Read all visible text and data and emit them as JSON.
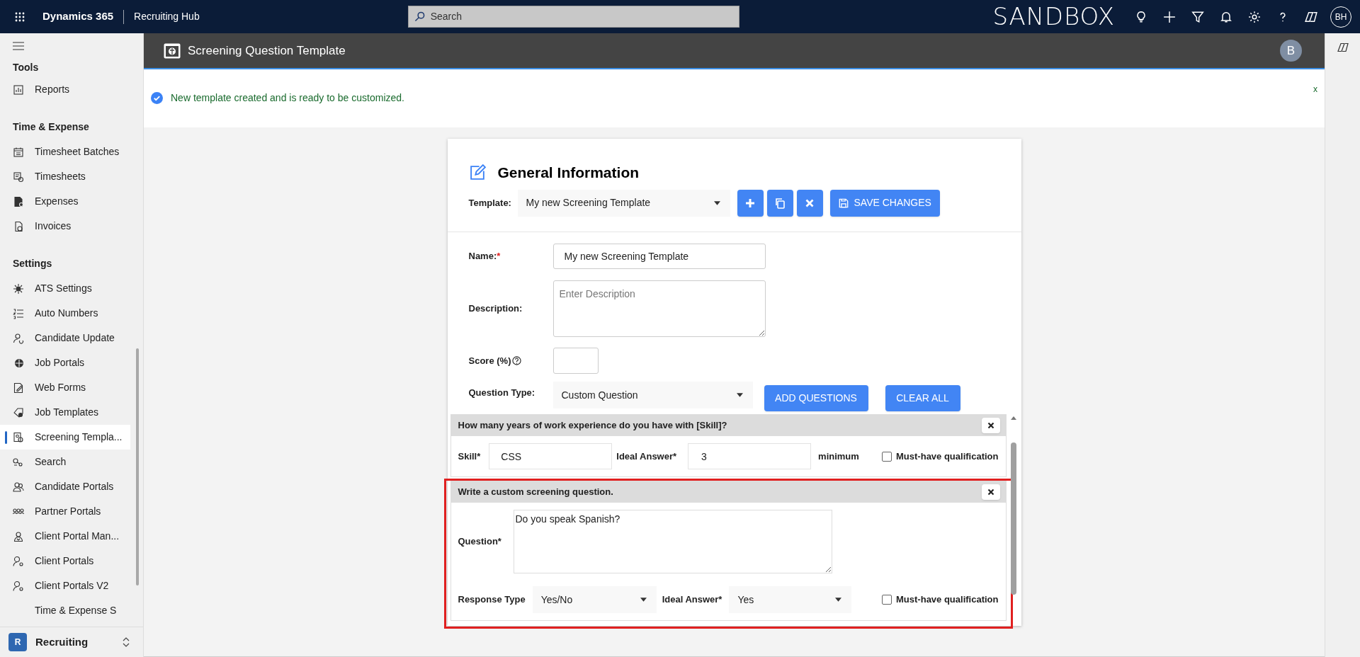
{
  "app_bar": {
    "app_name": "Dynamics 365",
    "area": "Recruiting Hub",
    "search_placeholder": "Search",
    "environment": "SANDBOX",
    "user_initials": "BH"
  },
  "sidebar": {
    "sections": [
      {
        "title": "Tools",
        "items": [
          {
            "label": "Reports",
            "selected": false
          }
        ]
      },
      {
        "title": "Time & Expense",
        "items": [
          {
            "label": "Timesheet Batches",
            "selected": false
          },
          {
            "label": "Timesheets",
            "selected": false
          },
          {
            "label": "Expenses",
            "selected": false
          },
          {
            "label": "Invoices",
            "selected": false
          }
        ]
      },
      {
        "title": "Settings",
        "items": [
          {
            "label": "ATS Settings",
            "selected": false
          },
          {
            "label": "Auto Numbers",
            "selected": false
          },
          {
            "label": "Candidate Update",
            "selected": false
          },
          {
            "label": "Job Portals",
            "selected": false
          },
          {
            "label": "Web Forms",
            "selected": false
          },
          {
            "label": "Job Templates",
            "selected": false
          },
          {
            "label": "Screening Templa...",
            "selected": true
          },
          {
            "label": "Search",
            "selected": false
          },
          {
            "label": "Candidate Portals",
            "selected": false
          },
          {
            "label": "Partner Portals",
            "selected": false
          },
          {
            "label": "Client Portal Man...",
            "selected": false
          },
          {
            "label": "Client Portals",
            "selected": false
          },
          {
            "label": "Client Portals V2",
            "selected": false
          },
          {
            "label": "Time & Expense S",
            "selected": false
          }
        ]
      }
    ],
    "footer": {
      "badge": "R",
      "label": "Recruiting"
    }
  },
  "page_header": {
    "title": "Screening Question Template",
    "avatar": "B"
  },
  "notification": {
    "message": "New template created and is ready to be customized.",
    "close": "x"
  },
  "form": {
    "title": "General Information",
    "template_label": "Template:",
    "template_value": "My new Screening Template",
    "save_button": "SAVE CHANGES",
    "name_label": "Name:",
    "name_required": "*",
    "name_value": "My new Screening Template",
    "description_label": "Description:",
    "description_placeholder": "Enter Description",
    "score_label": "Score (%)",
    "question_type_label": "Question Type:",
    "question_type_value": "Custom Question",
    "add_button": "ADD QUESTIONS",
    "clear_button": "CLEAR ALL"
  },
  "questions": [
    {
      "kind": "skill",
      "title": "How many years of work experience do you have with [Skill]?",
      "highlighted": false,
      "skill_label": "Skill*",
      "skill_value": "CSS",
      "answer_label": "Ideal Answer*",
      "answer_value": "3",
      "suffix": "minimum",
      "must_have": {
        "label": "Must-have qualification",
        "checked": false
      }
    },
    {
      "kind": "custom",
      "title": "Write a custom screening question.",
      "highlighted": true,
      "question_label": "Question*",
      "question_value": "Do you speak Spanish?",
      "response_label": "Response Type",
      "response_value": "Yes/No",
      "answer_label": "Ideal Answer*",
      "answer_value": "Yes",
      "must_have": {
        "label": "Must-have qualification",
        "checked": false
      }
    }
  ]
}
